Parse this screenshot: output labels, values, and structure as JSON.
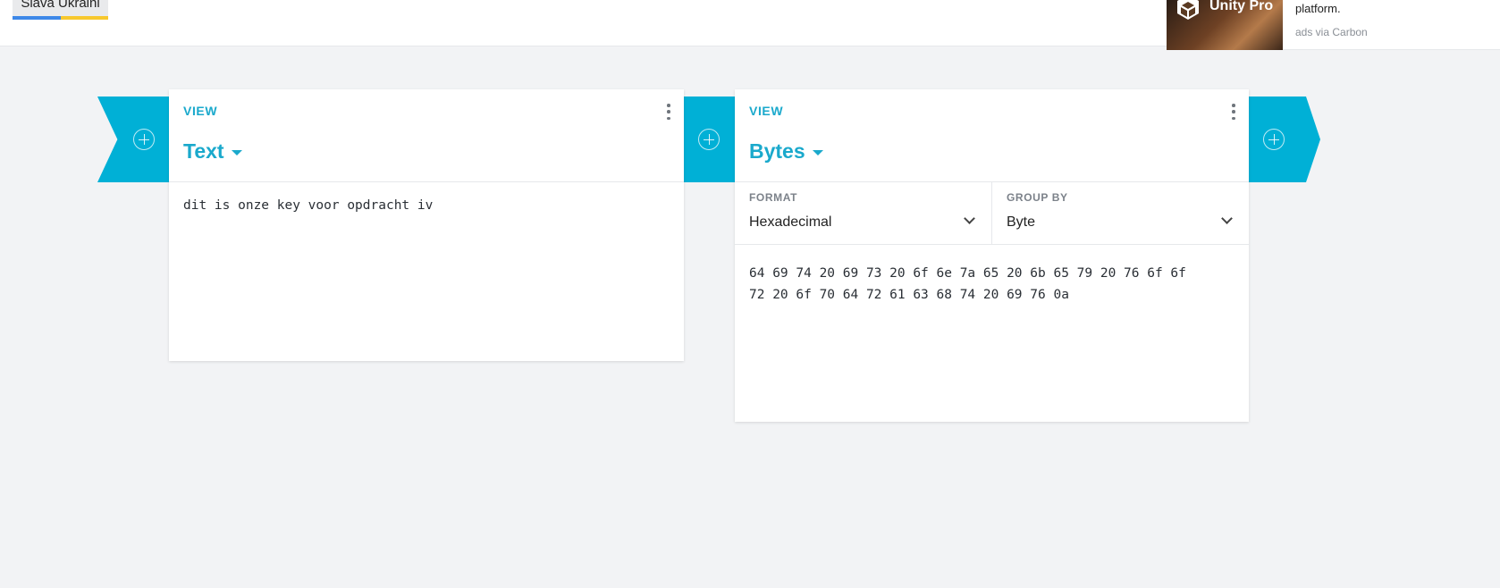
{
  "topbar": {
    "slava_label": "Slava Ukraini"
  },
  "ad": {
    "brand": "Unity Pro",
    "text": "platform.",
    "via": "ads via Carbon"
  },
  "panels": {
    "text": {
      "view_label": "VIEW",
      "title": "Text",
      "content": "dit is onze key voor opdracht iv"
    },
    "bytes": {
      "view_label": "VIEW",
      "title": "Bytes",
      "format_label": "FORMAT",
      "format_value": "Hexadecimal",
      "group_label": "GROUP BY",
      "group_value": "Byte",
      "line1": "64 69 74 20 69 73 20 6f 6e 7a 65 20 6b 65 79 20 76 6f 6f",
      "line2": "72 20 6f 70 64 72 61 63 68 74 20 69 76 0a"
    }
  },
  "colors": {
    "accent": "#1aa9cc",
    "strip": "#00b0d6",
    "background": "#f2f3f5"
  }
}
